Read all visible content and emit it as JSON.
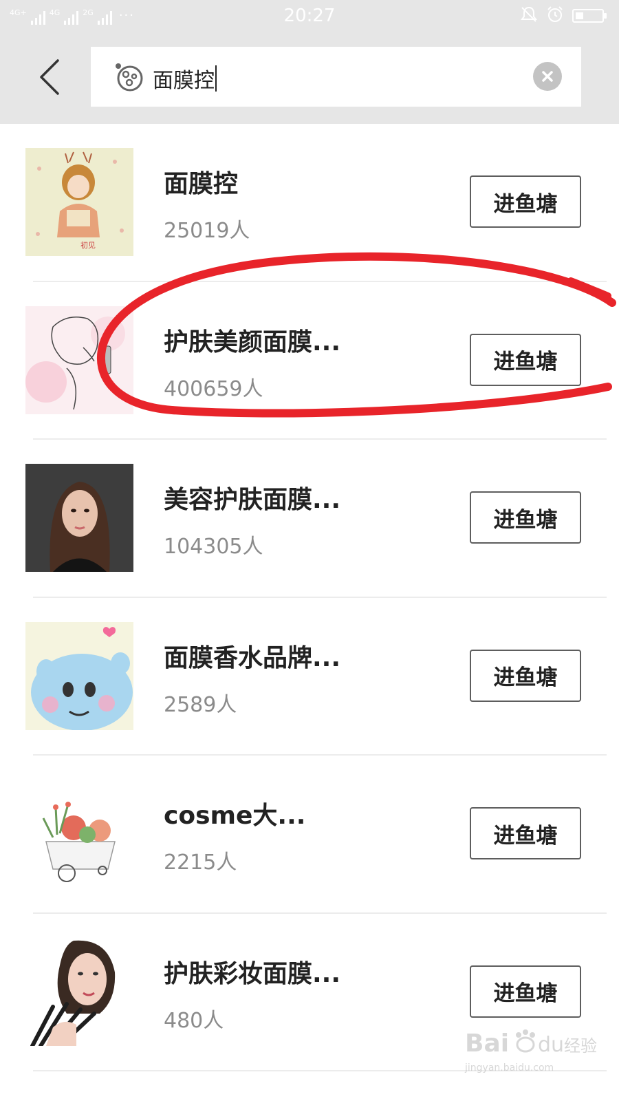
{
  "status_bar": {
    "network_1": "4G+",
    "network_2": "4G",
    "network_3": "2G",
    "more": "···",
    "time": "20:27",
    "battery_level": 0.3
  },
  "search": {
    "query": "面膜控"
  },
  "results": [
    {
      "title": "面膜控",
      "count": "25019人",
      "button": "进鱼塘",
      "avatar_icon": "girl-with-antlers-illustration"
    },
    {
      "title": "护肤美颜面膜...",
      "count": "400659人",
      "button": "进鱼塘",
      "avatar_icon": "woman-with-perfume-illustration"
    },
    {
      "title": "美容护肤面膜...",
      "count": "104305人",
      "button": "进鱼塘",
      "avatar_icon": "woman-portrait-photo"
    },
    {
      "title": "面膜香水品牌...",
      "count": "2589人",
      "button": "进鱼塘",
      "avatar_icon": "blue-hippo-cartoon"
    },
    {
      "title": "cosme大...",
      "count": "2215人",
      "button": "进鱼塘",
      "avatar_icon": "succulent-plant-cart"
    },
    {
      "title": "护肤彩妆面膜...",
      "count": "480人",
      "button": "进鱼塘",
      "avatar_icon": "woman-with-makeup-brushes"
    }
  ],
  "colors": {
    "header_bg": "#e6e6e6",
    "annotation": "#e8242a",
    "count_text": "#8b8b8b"
  },
  "watermark": {
    "brand": "Baidu经验",
    "url": "jingyan.baidu.com"
  }
}
